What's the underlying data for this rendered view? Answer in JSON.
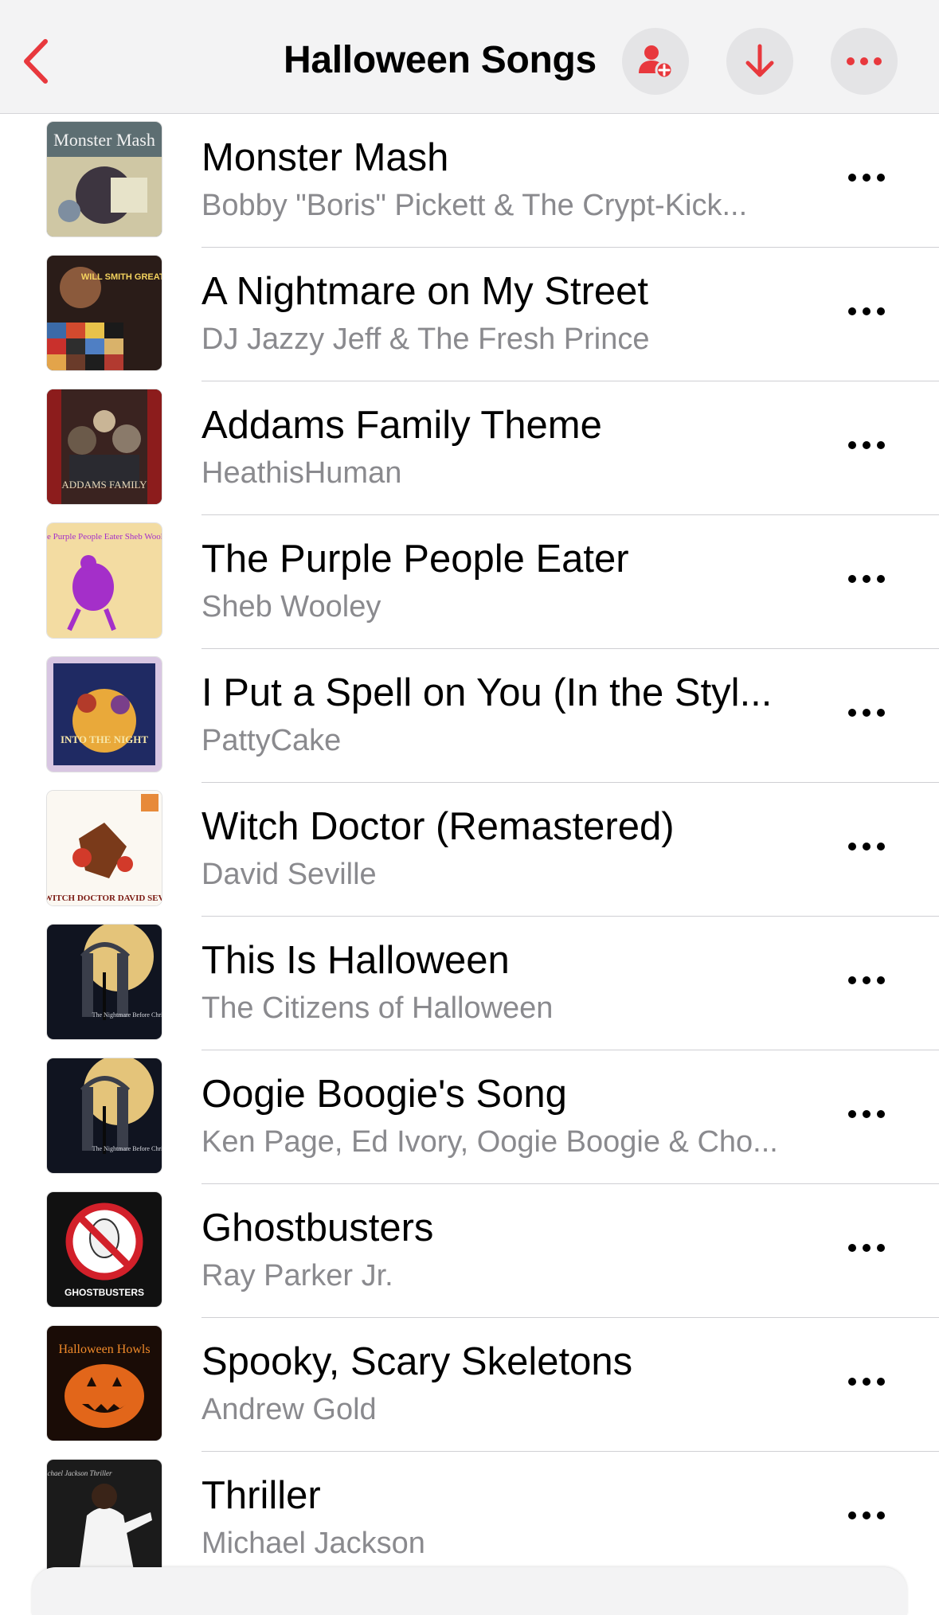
{
  "colors": {
    "accent": "#e8383d",
    "secondary_text": "#8a8a8e",
    "nav_bg": "#f3f3f4"
  },
  "nav": {
    "title": "Halloween Songs",
    "back_icon": "chevron-left-icon",
    "buttons": [
      {
        "icon": "add-person-icon"
      },
      {
        "icon": "download-arrow-icon"
      },
      {
        "icon": "more-icon"
      }
    ]
  },
  "songs": [
    {
      "title": "Monster Mash",
      "artist": "Bobby \"Boris\" Pickett & The Crypt-Kick...",
      "art_text": "Monster Mash"
    },
    {
      "title": "A Nightmare on My Street",
      "artist": "DJ Jazzy Jeff & The Fresh Prince",
      "art_text": "WILL SMITH GREATEST HITS"
    },
    {
      "title": "Addams Family Theme",
      "artist": "HeathisHuman",
      "art_text": "ADDAMS FAMILY"
    },
    {
      "title": "The Purple People Eater",
      "artist": "Sheb Wooley",
      "art_text": "The Purple People Eater Sheb Wooley"
    },
    {
      "title": "I Put a Spell on You (In the Styl...",
      "artist": "PattyCake",
      "art_text": "INTO THE NIGHT"
    },
    {
      "title": "Witch Doctor (Remastered)",
      "artist": "David Seville",
      "art_text": "THE WITCH DOCTOR DAVID SEVILLE"
    },
    {
      "title": "This Is Halloween",
      "artist": "The Citizens of Halloween",
      "art_text": "The Nightmare Before Christmas"
    },
    {
      "title": "Oogie Boogie's Song",
      "artist": "Ken Page, Ed Ivory, Oogie Boogie & Cho...",
      "art_text": "The Nightmare Before Christmas"
    },
    {
      "title": "Ghostbusters",
      "artist": "Ray Parker Jr.",
      "art_text": "GHOSTBUSTERS"
    },
    {
      "title": "Spooky, Scary Skeletons",
      "artist": "Andrew Gold",
      "art_text": "Halloween Howls"
    },
    {
      "title": "Thriller",
      "artist": "Michael Jackson",
      "art_text": "Michael Jackson Thriller"
    }
  ]
}
